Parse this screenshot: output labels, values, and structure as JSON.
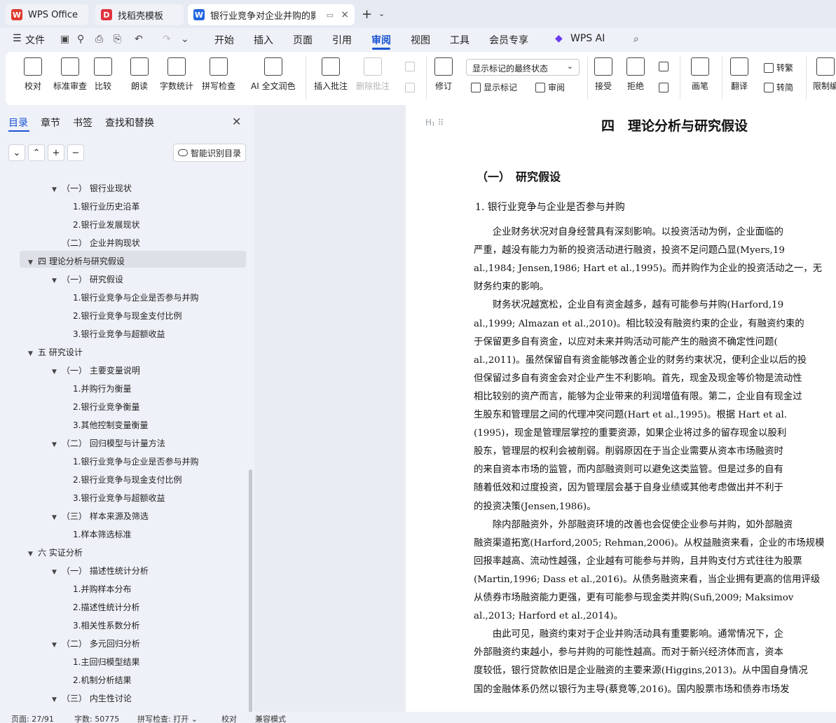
{
  "window": {
    "tabs": [
      {
        "label": "WPS Office",
        "icon": "wps-logo-icon",
        "color": "#e03a2f"
      },
      {
        "label": "找稻壳模板",
        "icon": "docer-icon",
        "color": "#e0333d"
      },
      {
        "label": "银行业竞争对企业并购的影响",
        "icon": "word-doc-icon",
        "color": "#2266e0"
      }
    ],
    "new_tab": "+",
    "close": "×"
  },
  "menubar": {
    "file": "文件",
    "items": [
      "开始",
      "插入",
      "页面",
      "引用",
      "审阅",
      "视图",
      "工具",
      "会员专享"
    ],
    "active": "审阅",
    "ai": "WPS AI"
  },
  "ribbon": {
    "proofread": "校对",
    "standard_review": "标准审查",
    "compare": "比较",
    "read_aloud": "朗读",
    "word_count": "字数统计",
    "spell_check": "拼写检查",
    "ai_polish": "AI 全文润色",
    "insert_comment": "插入批注",
    "delete_comment": "删除批注",
    "revise": "修订",
    "markup_mode": "显示标记的最终状态",
    "show_markup": "显示标记",
    "review": "审阅",
    "accept": "接受",
    "reject": "拒绝",
    "pen": "画笔",
    "translate": "翻译",
    "to_traditional": "转繁",
    "to_simplified": "转简",
    "restrict": "限制编"
  },
  "nav": {
    "tabs": [
      "目录",
      "章节",
      "书签",
      "查找和替换"
    ],
    "smart_toc": "智能识别目录",
    "toc": [
      {
        "text": "（一） 银行业现状",
        "level": 2,
        "arrow": "▼"
      },
      {
        "text": "1.银行业历史沿革",
        "level": 3,
        "arrow": ""
      },
      {
        "text": "2.银行业发展现状",
        "level": 3,
        "arrow": ""
      },
      {
        "text": "（二） 企业并购现状",
        "level": 2,
        "arrow": ""
      },
      {
        "text": "四 理论分析与研究假设",
        "level": 1,
        "arrow": "▼"
      },
      {
        "text": "（一） 研究假设",
        "level": 2,
        "arrow": "▼"
      },
      {
        "text": "1.银行业竞争与企业是否参与并购",
        "level": 3,
        "arrow": ""
      },
      {
        "text": "2.银行业竞争与现金支付比例",
        "level": 3,
        "arrow": ""
      },
      {
        "text": "3.银行业竞争与超额收益",
        "level": 3,
        "arrow": ""
      },
      {
        "text": "五 研究设计",
        "level": 1,
        "arrow": "▼"
      },
      {
        "text": "（一） 主要变量说明",
        "level": 2,
        "arrow": "▼"
      },
      {
        "text": "1.并购行为衡量",
        "level": 3,
        "arrow": ""
      },
      {
        "text": "2.银行业竞争衡量",
        "level": 3,
        "arrow": ""
      },
      {
        "text": "3.其他控制变量衡量",
        "level": 3,
        "arrow": ""
      },
      {
        "text": "（二） 回归模型与计量方法",
        "level": 2,
        "arrow": "▼"
      },
      {
        "text": "1.银行业竞争与企业是否参与并购",
        "level": 3,
        "arrow": ""
      },
      {
        "text": "2.银行业竞争与现金支付比例",
        "level": 3,
        "arrow": ""
      },
      {
        "text": "3.银行业竞争与超额收益",
        "level": 3,
        "arrow": ""
      },
      {
        "text": "（三） 样本来源及筛选",
        "level": 2,
        "arrow": "▼"
      },
      {
        "text": "1.样本筛选标准",
        "level": 3,
        "arrow": ""
      },
      {
        "text": "六 实证分析",
        "level": 1,
        "arrow": "▼"
      },
      {
        "text": "（一） 描述性统计分析",
        "level": 2,
        "arrow": "▼"
      },
      {
        "text": "1.并购样本分布",
        "level": 3,
        "arrow": ""
      },
      {
        "text": "2.描述性统计分析",
        "level": 3,
        "arrow": ""
      },
      {
        "text": "3.相关性系数分析",
        "level": 3,
        "arrow": ""
      },
      {
        "text": "（二） 多元回归分析",
        "level": 2,
        "arrow": "▼"
      },
      {
        "text": "1.主回归模型结果",
        "level": 3,
        "arrow": ""
      },
      {
        "text": "2.机制分析结果",
        "level": 3,
        "arrow": ""
      },
      {
        "text": "（三） 内生性讨论",
        "level": 2,
        "arrow": "▼"
      }
    ],
    "selected_index": 4
  },
  "doc": {
    "heading_marker": "H₁ ⠿",
    "h1": "四　理论分析与研究假设",
    "h2": "（一）　研究假设",
    "h3": "1.  银行业竞争与企业是否参与并购",
    "lines": [
      "　　企业财务状况对自身经营具有深刻影响。以投资活动为例，企业面临的",
      "严重，越没有能力为新的投资活动进行融资，投资不足问题凸显(Myers,19",
      "al.,1984; Jensen,1986; Hart et al.,1995)。而并购作为企业的投资活动之一，无",
      "财务约束的影响。",
      "　　财务状况越宽松，企业自有资金越多，越有可能参与并购(Harford,19",
      "al.,1999; Almazan et al.,2010)。相比较没有融资约束的企业，有融资约束的",
      "于保留更多自有资金，以应对未来并购活动可能产生的融资不确定性问题(",
      "al.,2011)。虽然保留自有资金能够改善企业的财务约束状况，便利企业以后的投",
      "但保留过多自有资金会对企业产生不利影响。首先，现金及现金等价物是流动性",
      "相比较别的资产而言，能够为企业带来的利润增值有限。第二，企业自有现金过",
      "生股东和管理层之间的代理冲突问题(Hart et al.,1995)。根据 Hart et al.",
      "(1995)，现金是管理层掌控的重要资源，如果企业将过多的留存现金以股利",
      "股东，管理层的权利会被削弱。削弱原因在于当企业需要从资本市场融资时",
      "的来自资本市场的监管，而内部融资则可以避免这类监管。但是过多的自有",
      "随着低效和过度投资，因为管理层会基于自身业绩或其他考虑做出并不利于",
      "的投资决策(Jensen,1986)。",
      "　　除内部融资外，外部融资环境的改善也会促使企业参与并购，如外部融资",
      "融资渠道拓宽(Harford,2005; Rehman,2006)。从权益融资来看，企业的市场规模",
      "回报率越高、流动性越强，企业越有可能参与并购，且并购支付方式往往为股票",
      "(Martin,1996; Dass et al.,2016)。从债务融资来看，当企业拥有更高的信用评级",
      "从债券市场融资能力更强，更有可能参与现金类并购(Sufi,2009; Maksimov",
      "al.,2013; Harford et al.,2014)。",
      "　　由此可见，融资约束对于企业并购活动具有重要影响。通常情况下，企",
      "外部融资约束越小，参与并购的可能性越高。而对于新兴经济体而言，资本",
      "度较低，银行贷款依旧是企业融资的主要来源(Higgins,2013)。从中国自身情况",
      "国的金融体系仍然以银行为主导(蔡竞等,2016)。国内股票市场和债券市场发"
    ]
  },
  "status": {
    "page": "页面: 27/91",
    "words": "字数: 50775",
    "spell": "拼写检查: 打开 ⌄",
    "proof": "校对",
    "compat": "兼容模式"
  }
}
